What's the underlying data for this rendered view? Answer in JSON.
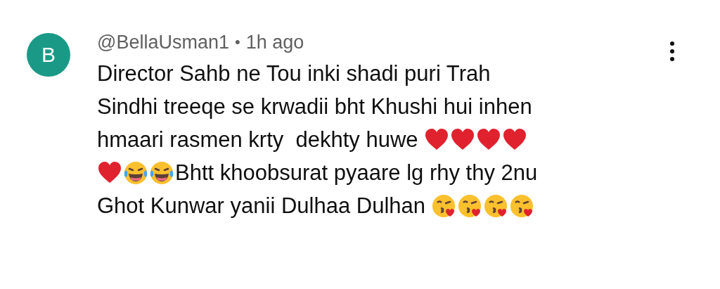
{
  "comment": {
    "avatar_letter": "B",
    "author": "@BellaUsman1",
    "separator": "•",
    "time": "1h ago",
    "lines": [
      [
        {
          "kind": "text",
          "text": "Director Sahb ne Tou inki shadi puri Trah"
        }
      ],
      [
        {
          "kind": "text",
          "text": "Sindhi treeqe se krwadii bht Khushi hui inhen"
        }
      ],
      [
        {
          "kind": "text",
          "text": "hmaari rasmen krty  dekhty huwe"
        },
        {
          "kind": "heart"
        },
        {
          "kind": "heart"
        },
        {
          "kind": "heart"
        },
        {
          "kind": "heart"
        }
      ],
      [
        {
          "kind": "heart"
        },
        {
          "kind": "laugh"
        },
        {
          "kind": "laugh"
        },
        {
          "kind": "text",
          "text": "Bhtt khoobsurat pyaare lg rhy thy 2nu"
        }
      ],
      [
        {
          "kind": "text",
          "text": "Ghot Kunwar yanii Dulhaa Dulhan"
        },
        {
          "kind": "kiss"
        },
        {
          "kind": "kiss"
        },
        {
          "kind": "kiss"
        },
        {
          "kind": "kiss"
        }
      ]
    ]
  }
}
